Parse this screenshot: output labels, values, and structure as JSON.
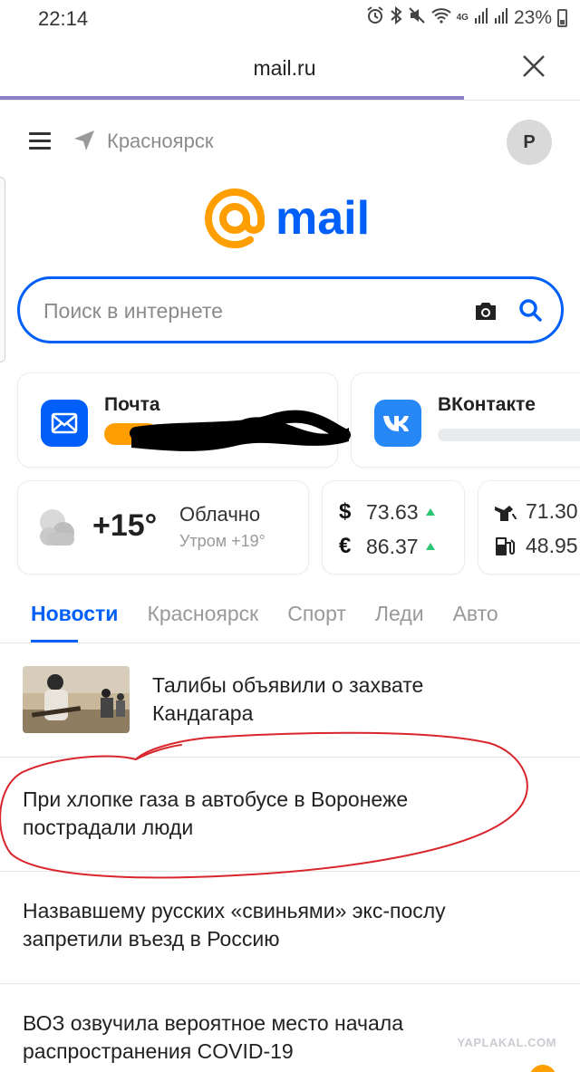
{
  "status": {
    "time": "22:14",
    "battery": "23%",
    "net_4g": "4G",
    "roaming": "R"
  },
  "browser": {
    "url": "mail.ru"
  },
  "header": {
    "city": "Красноярск",
    "avatar_letter": "Р"
  },
  "logo": {
    "word": "mail"
  },
  "search": {
    "placeholder": "Поиск в интернете"
  },
  "services": [
    {
      "title": "Почта"
    },
    {
      "title": "ВКонтакте"
    }
  ],
  "weather": {
    "temp": "+15°",
    "desc": "Облачно",
    "morning": "Утром +19°"
  },
  "currency": [
    {
      "symbol": "$",
      "value": "73.63"
    },
    {
      "symbol": "€",
      "value": "86.37"
    }
  ],
  "oil": [
    {
      "value": "71.30"
    },
    {
      "value": "48.95"
    }
  ],
  "tabs": [
    {
      "label": "Новости",
      "active": true
    },
    {
      "label": "Красноярск"
    },
    {
      "label": "Спорт"
    },
    {
      "label": "Леди"
    },
    {
      "label": "Авто"
    }
  ],
  "news": [
    {
      "title_line1": "Талибы объявили о захвате",
      "title_line2": "Кандагара"
    },
    {
      "title_line1": "При хлопке газа в автобусе в Воронеже",
      "title_line2": "пострадали люди"
    },
    {
      "title_line1": "Назвавшему русских «свиньями» экс-послу",
      "title_line2": "запретили въезд в Россию"
    },
    {
      "title_line1": "ВОЗ озвучила вероятное место начала",
      "title_line2": "распространения COVID-19"
    }
  ],
  "watermark": "YAPLAKAL.COM",
  "colors": {
    "accent": "#005ff9",
    "mail_orange": "#ff9e00",
    "vk_blue": "#2787f5",
    "up_green": "#2ac670",
    "annotation_red": "#d9262c"
  }
}
